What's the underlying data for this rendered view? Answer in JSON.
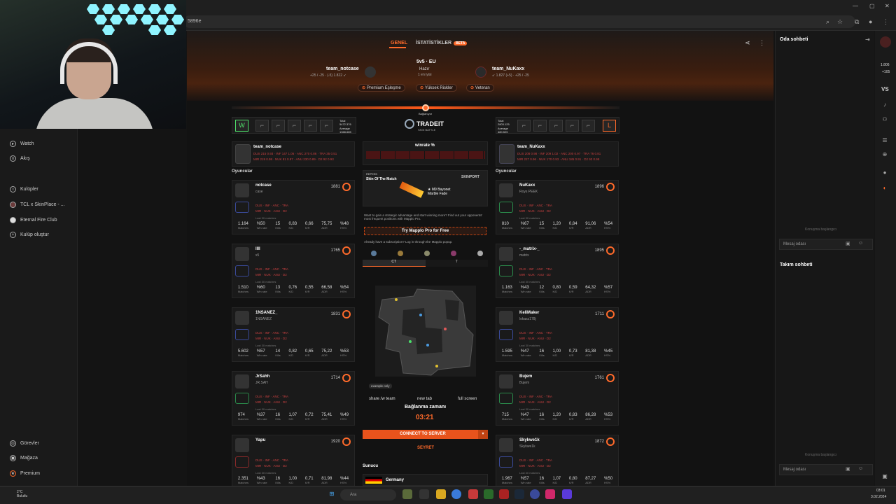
{
  "browser": {
    "url_fragment": "5896e"
  },
  "tabs": [
    {
      "label": "GENEL"
    },
    {
      "label": "İSTATİSTİKLER",
      "badge": "BETA"
    }
  ],
  "match": {
    "mode": "5v5 · EU",
    "status": "Hazır",
    "status_sub": "1 en iyisi",
    "team_a": {
      "name": "team_notcase",
      "elo_line": "+25 / -25 · (-5) 1.822 ↙"
    },
    "team_b": {
      "name": "team_NuKaxx",
      "elo_line": "↙ 1.827 (+5) · +25 / -25"
    },
    "pills": [
      "Premium Eşleşme",
      "Yüksek Riskler",
      "Veteran"
    ],
    "progress_label": "Bağlanıyor",
    "team_a_total": {
      "total": "Total\n5472.376",
      "avg": "Average\n1368.685"
    },
    "team_b_total": {
      "total": "Total\n2803.125",
      "avg": "Average\n480.525"
    },
    "sponsor": {
      "name": "TRADEIT",
      "sub": "SKIN BATTLE"
    },
    "left_result": "W",
    "right_result": "L"
  },
  "sidebar": {
    "items": [
      {
        "label": "Watch",
        "icon": "watch-icon",
        "top": 0
      },
      {
        "label": "Akış",
        "icon": "feed-icon"
      },
      {
        "label": "Kulüpler",
        "icon": "clubs-icon"
      },
      {
        "label": "TCL x SkinPlace - ...",
        "icon": "club-avatar-icon"
      },
      {
        "label": "Eternal Fire Club",
        "icon": "club-avatar-icon"
      },
      {
        "label": "Kulüp oluştur",
        "icon": "plus-icon"
      }
    ],
    "bottom": [
      {
        "label": "Görevler",
        "icon": "missions-icon"
      },
      {
        "label": "Mağaza",
        "icon": "shop-icon"
      },
      {
        "label": "Premium",
        "icon": "premium-icon"
      }
    ]
  },
  "left_team": {
    "header_name": "team_notcase",
    "section": "Oyuncular",
    "players": [
      {
        "name": "notcase",
        "sub": "case",
        "elo": "1881",
        "bottom": [
          "1.164",
          "%50",
          "15",
          "0,83",
          "0,66",
          "75,75",
          "%48"
        ]
      },
      {
        "name": "llll",
        "sub": "x5",
        "elo": "1765",
        "bottom": [
          "1.510",
          "%60",
          "13",
          "0,76",
          "0,55",
          "66,58",
          "%54"
        ]
      },
      {
        "name": "1NSANEZ_",
        "sub": "1NSANEZ",
        "elo": "1831",
        "bottom": [
          "5.602",
          "%57",
          "14",
          "0,82",
          "0,65",
          "75,22",
          "%53"
        ]
      },
      {
        "name": "JrSahh",
        "sub": "JR.SAH",
        "elo": "1714",
        "bottom": [
          "974",
          "%37",
          "16",
          "1,07",
          "0,72",
          "75,41",
          "%49"
        ]
      },
      {
        "name": "Yapu",
        "sub": "",
        "elo": "1920",
        "bottom": [
          "2.351",
          "%43",
          "16",
          "1,00",
          "0,71",
          "81,98",
          "%44"
        ]
      }
    ]
  },
  "right_team": {
    "header_name": "team_NuKaxx",
    "section": "Oyuncular",
    "players": [
      {
        "name": "NuKaxx",
        "sub": "Roys PEEK",
        "elo": "1896",
        "bottom": [
          "810",
          "%67",
          "15",
          "1,20",
          "0,84",
          "91,06",
          "%54"
        ]
      },
      {
        "name": "-_matrix-_",
        "sub": "matrix",
        "elo": "1895",
        "bottom": [
          "1.163",
          "%43",
          "12",
          "0,80",
          "0,59",
          "64,32",
          "%57"
        ]
      },
      {
        "name": "KeliMaker",
        "sub": "lokasz178j",
        "elo": "1711",
        "bottom": [
          "1.595",
          "%47",
          "16",
          "1,00",
          "0,73",
          "81,38",
          "%45"
        ]
      },
      {
        "name": "Bujem",
        "sub": "Bujem",
        "elo": "1761",
        "bottom": [
          "715",
          "%47",
          "16",
          "1,20",
          "0,83",
          "86,28",
          "%53"
        ]
      },
      {
        "name": "Skykwe1k",
        "sub": "Skykwe1k",
        "elo": "1872",
        "bottom": [
          "1.967",
          "%57",
          "16",
          "1,07",
          "0,80",
          "87,27",
          "%50"
        ]
      }
    ]
  },
  "stat_labels": [
    "Matches",
    "Win rate",
    "Kills",
    "K/D",
    "K/R",
    "ADR",
    "HS%"
  ],
  "middle": {
    "winrate_title": "winrate %",
    "skin_title": "Skin Of The Match",
    "skin_source": "REPEEK",
    "skin_powered": "SKINPORT",
    "skin_name": "★ M9 Bayonet\nMarble Fade",
    "promo_text": "Want to gain a strategic advantage and start winning more? Find out your opponents' most frequent positions with Mapplo Pro.",
    "promo_button": "Try Mapplo Pro for Free",
    "subscription_text": "Already have a subscription? Log in through the Mapplo popup.",
    "side_ct": "CT",
    "side_t": "T",
    "example": "example only",
    "actions": [
      "share /w team",
      "new tab",
      "full screen"
    ],
    "connect_title": "Bağlanma zamanı",
    "timer": "03:21",
    "connect_button": "CONNECT TO SERVER",
    "watch": "SEYRET",
    "server_label": "Sunucu",
    "server_country": "Germany"
  },
  "chat": {
    "room_title": "Oda sohbeti",
    "started": "Konuşma başlangıcı",
    "placeholder": "Mesaj odası",
    "team_title": "Takım sohbeti",
    "team_started": "Konuşma başlangıcı",
    "team_placeholder": "Mesaj odası"
  },
  "rightbar": {
    "vs": "VS",
    "points": "1.806",
    "points2": "+105"
  },
  "taskbar": {
    "weather": "2°C\nBulutlu",
    "search": "Ara",
    "time": "03:01",
    "date": "3.02.2024"
  },
  "colors": {
    "accent": "#ff6a2a",
    "win": "#4fe06a",
    "background": "#121212"
  }
}
